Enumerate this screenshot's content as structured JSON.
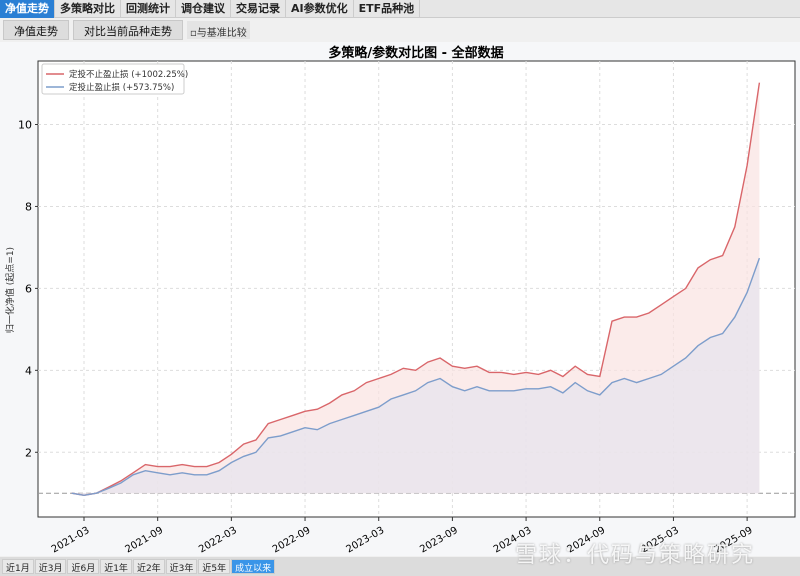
{
  "tabs": [
    "净值走势",
    "多策略对比",
    "回测统计",
    "调仓建议",
    "交易记录",
    "AI参数优化",
    "ETF品种池"
  ],
  "toolbar": {
    "nav_btn": "净值走势",
    "compare_btn": "对比当前品种走势",
    "benchmark_checkbox": "与基准比较"
  },
  "range_buttons": [
    "近1月",
    "近3月",
    "近6月",
    "近1年",
    "近2年",
    "近3年",
    "近5年",
    "成立以来"
  ],
  "watermark": "雪球：代码与策略研究",
  "chart_data": {
    "type": "line",
    "title": "多策略/参数对比图 - 全部数据",
    "xlabel": "",
    "ylabel": "归一化净值 (起点=1)",
    "ylim": [
      0.42,
      11.55
    ],
    "yticks": [
      "2",
      "4",
      "6",
      "8",
      "10"
    ],
    "xticks": [
      "2021-03",
      "2021-09",
      "2022-03",
      "2022-09",
      "2023-03",
      "2023-09",
      "2024-03",
      "2024-09",
      "2025-03",
      "2025-09"
    ],
    "reference_line": 1,
    "legend_position": "top-left",
    "x_start": "2021-02",
    "series": [
      {
        "name": "定投不止盈止损 (+1002.25%)",
        "color": "#d9666a",
        "fill": "#f9e3e1",
        "values": [
          1.0,
          0.95,
          1.0,
          1.15,
          1.3,
          1.5,
          1.7,
          1.65,
          1.65,
          1.7,
          1.65,
          1.65,
          1.75,
          1.95,
          2.2,
          2.3,
          2.7,
          2.8,
          2.9,
          3.0,
          3.05,
          3.2,
          3.4,
          3.5,
          3.7,
          3.8,
          3.9,
          4.05,
          4.0,
          4.2,
          4.3,
          4.1,
          4.05,
          4.1,
          3.95,
          3.95,
          3.9,
          3.95,
          3.9,
          4.0,
          3.85,
          4.1,
          3.9,
          3.85,
          5.2,
          5.3,
          5.3,
          5.4,
          5.6,
          5.8,
          6.0,
          6.5,
          6.7,
          6.8,
          7.5,
          9.0,
          11.02
        ]
      },
      {
        "name": "定投止盈止损 (+573.75%)",
        "color": "#7d9dcb",
        "fill": "#e6e4ee",
        "values": [
          1.0,
          0.95,
          1.0,
          1.12,
          1.25,
          1.45,
          1.55,
          1.5,
          1.45,
          1.5,
          1.45,
          1.45,
          1.55,
          1.75,
          1.9,
          2.0,
          2.35,
          2.4,
          2.5,
          2.6,
          2.55,
          2.7,
          2.8,
          2.9,
          3.0,
          3.1,
          3.3,
          3.4,
          3.5,
          3.7,
          3.8,
          3.6,
          3.5,
          3.6,
          3.5,
          3.5,
          3.5,
          3.55,
          3.55,
          3.6,
          3.45,
          3.7,
          3.5,
          3.4,
          3.7,
          3.8,
          3.7,
          3.8,
          3.9,
          4.1,
          4.3,
          4.6,
          4.8,
          4.9,
          5.3,
          5.9,
          6.74
        ]
      }
    ]
  }
}
